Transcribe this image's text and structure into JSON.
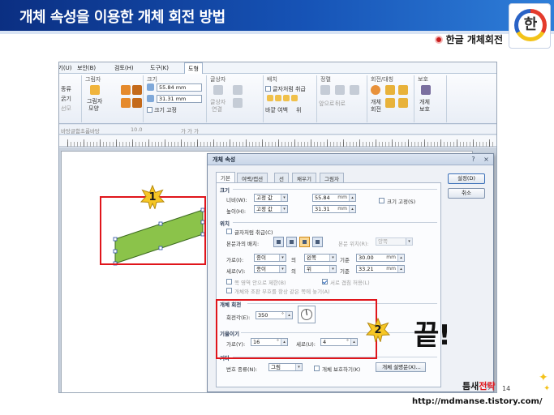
{
  "slide": {
    "title": "개체 속성을 이용한 개체 회전 방법",
    "subtitle": "한글 개체회전",
    "logo_glyph": "한",
    "end_text": "끝!",
    "brand_first": "틈새",
    "brand_second": "전략",
    "url": "http://mdmanse.tistory.com/",
    "page": "14",
    "badge1": "1",
    "badge2": "2",
    "accent_red": "#e0151b",
    "header_blue": "#1653b6",
    "shape_green": "#8bc34a"
  },
  "ribbon": {
    "tabs": [
      "보기(U)",
      "보안(B)",
      "검토(H)",
      "도구(K)",
      "도형"
    ],
    "groups": {
      "picture": {
        "title": "그림자",
        "line1": "그림자",
        "line2": "모양"
      },
      "size": {
        "title": "크기",
        "width": "55.84",
        "height": "31.31",
        "unit": "mm",
        "lock": "크기 고정"
      },
      "text_placement": {
        "title": "글상자",
        "line1": "글상자",
        "line2": "연결"
      },
      "arrange": {
        "title": "배치",
        "line1": "글자처럼 취급",
        "line2": "바깥 여백",
        "line3": "위"
      },
      "align": {
        "title": "정렬",
        "line1": "앞으로",
        "line2": "뒤로"
      },
      "rotate": {
        "title": "회전/대칭",
        "line1": "개체",
        "line2": "회전"
      },
      "protect": {
        "title": "보호",
        "line1": "개체",
        "line2": "보호"
      },
      "left_items": [
        "종류",
        "굵기",
        "선모"
      ]
    }
  },
  "format_bar": {
    "style": "바탕글",
    "font": "함초롬바탕",
    "size": "10.0",
    "styles": "가 가 가"
  },
  "dialog": {
    "title": "개체 속성",
    "help": "?",
    "close": "×",
    "tabs": [
      "기본",
      "여백/캡션",
      "선",
      "채우기",
      "그림자"
    ],
    "ok": "설정(D)",
    "cancel": "취소",
    "size_section": "크기",
    "width_label": "너비(W):",
    "width_mode": "고정 값",
    "width_value": "55.84",
    "height_label": "높이(H):",
    "height_mode": "고정 값",
    "height_value": "31.31",
    "unit": "mm",
    "size_lock": "크기 고정(S)",
    "position_section": "위치",
    "treat_as_char": "글자처럼 취급(C)",
    "text_wrap_label": "본문과의 배치:",
    "page_area_label": "본문 위치(R):",
    "page_area_value": "양쪽",
    "horiz_label": "가로(I):",
    "horiz_ref": "종이",
    "of1": "의",
    "horiz_side": "왼쪽",
    "basis1": "기준",
    "horiz_value": "30.00",
    "vert_label": "세로(V):",
    "vert_ref": "종이",
    "of2": "의",
    "vert_side": "위",
    "basis2": "기준",
    "vert_value": "33.21",
    "opt1": "쪽 영역 안으로 제한(B)",
    "opt2": "서로 겹침 허용(L)",
    "opt3": "개체와 조판 부호를 항상 같은 쪽에 놓기(A)",
    "rotation_section": "개체 회전",
    "rotation_label": "회전각(E):",
    "rotation_value": "350",
    "rotation_unit": "°",
    "skew_section": "기울이기",
    "skew_h_label": "가로(Y):",
    "skew_h_value": "16",
    "skew_v_label": "세로(U):",
    "skew_v_value": "4",
    "other_section": "기타",
    "number_type_label": "번호 종류(N):",
    "number_type_value": "그림",
    "protect_obj": "개체 보호하기(K)",
    "obj_desc": "개체 설명문(X)..."
  }
}
